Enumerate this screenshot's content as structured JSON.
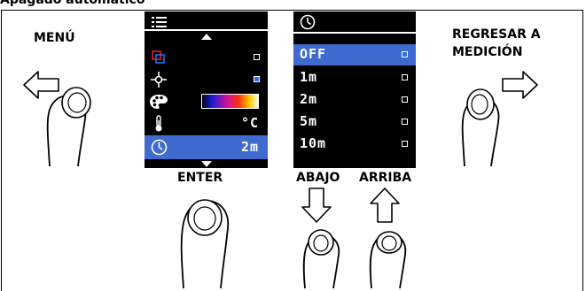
{
  "caption": "Apagado automático",
  "labels": {
    "menu": "MENÚ",
    "back_line1": "REGRESAR A",
    "back_line2": "MEDICIÓN",
    "enter": "ENTER",
    "down": "ABAJO",
    "up": "ARRIBA"
  },
  "menu_screen": {
    "header_icon": "list-icon",
    "rows": [
      {
        "icon": "color-frame-icon"
      },
      {
        "icon": "crosshair-icon"
      },
      {
        "icon": "palette-icon"
      },
      {
        "icon": "thermometer-icon",
        "value": "°C"
      },
      {
        "icon": "clock-icon",
        "value": "2m"
      }
    ]
  },
  "timeout_screen": {
    "header_icon": "clock-icon",
    "options": [
      "OFF",
      "1m",
      "2m",
      "5m",
      "10m"
    ]
  },
  "colors": {
    "highlight": "#3f6bd0",
    "checkbox_checked": "#2e6cf0"
  }
}
